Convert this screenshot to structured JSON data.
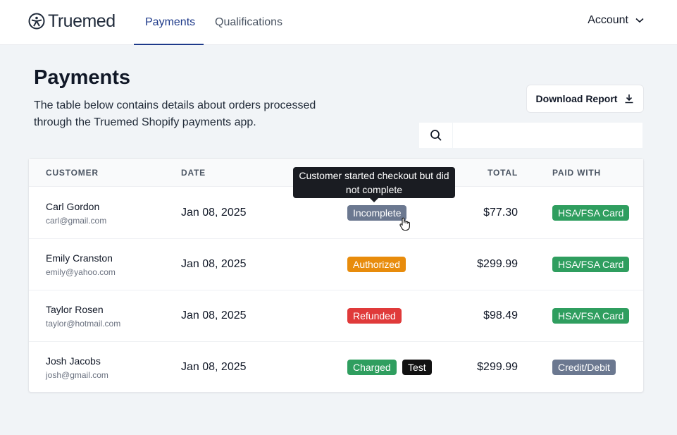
{
  "brand": {
    "name": "Truemed"
  },
  "nav": {
    "tabs": [
      {
        "label": "Payments",
        "active": true
      },
      {
        "label": "Qualifications",
        "active": false
      }
    ],
    "account_label": "Account"
  },
  "page": {
    "title": "Payments",
    "description": "The table below contains details about orders processed through the Truemed Shopify payments app."
  },
  "toolbar": {
    "download_label": "Download Report",
    "search_placeholder": ""
  },
  "table": {
    "headers": {
      "customer": "CUSTOMER",
      "date": "DATE",
      "total": "TOTAL",
      "paid_with": "PAID WITH"
    },
    "rows": [
      {
        "name": "Carl Gordon",
        "email": "carl@gmail.com",
        "date": "Jan 08, 2025",
        "status": "Incomplete",
        "status_color": "#6b7890",
        "test": "",
        "total": "$77.30",
        "paid_with": "HSA/FSA Card",
        "paid_color": "#2f9e5f"
      },
      {
        "name": "Emily Cranston",
        "email": "emily@yahoo.com",
        "date": "Jan 08, 2025",
        "status": "Authorized",
        "status_color": "#e88c0c",
        "test": "",
        "total": "$299.99",
        "paid_with": "HSA/FSA Card",
        "paid_color": "#2f9e5f"
      },
      {
        "name": "Taylor Rosen",
        "email": "taylor@hotmail.com",
        "date": "Jan 08, 2025",
        "status": "Refunded",
        "status_color": "#e03a3a",
        "test": "",
        "total": "$98.49",
        "paid_with": "HSA/FSA Card",
        "paid_color": "#2f9e5f"
      },
      {
        "name": "Josh Jacobs",
        "email": "josh@gmail.com",
        "date": "Jan 08, 2025",
        "status": "Charged",
        "status_color": "#2f9e5f",
        "test": "Test",
        "total": "$299.99",
        "paid_with": "Credit/Debit",
        "paid_color": "#6b7890"
      }
    ]
  },
  "tooltip": {
    "text": "Customer started checkout but did not complete"
  },
  "colors": {
    "accent": "#1e3a8a",
    "background": "#f1f4f7"
  }
}
